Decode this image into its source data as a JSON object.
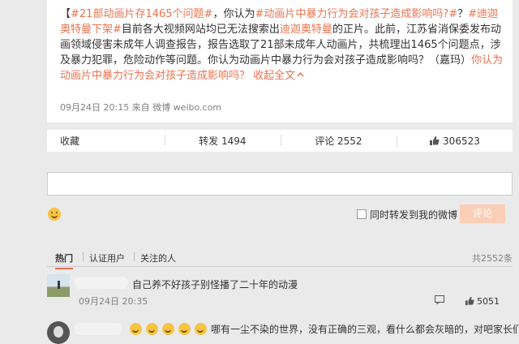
{
  "post": {
    "prefix": "【",
    "topic1": "#21部动画片存1465个问题#",
    "mid1": "，你认为",
    "topic2": "#动画片中暴力行为会对孩子造成影响吗?#",
    "mid2": "？",
    "topic3": "#迪迦奥特曼下架#",
    "body1": "目前各大视频网站均已无法搜索出",
    "link1": "迪迦奥特曼",
    "body2": "的正片。此前，江苏省消保委发布动画领域侵害未成年人调查报告，报告选取了21部未成年人动画片，共梳理出1465个问题点，涉及暴力犯罪，危险动作等问题。你认为动画片中暴力行为会对孩子造成影响吗？（嘉玛）",
    "link2": "你认为动画片中暴力行为会对孩子造成影响吗？",
    "collapse": "收起全文",
    "collapse_icon": "chevron-up"
  },
  "meta": "09月24日 20:15  来自 微博 weibo.com",
  "actions": {
    "collect": "收藏",
    "repost": "转发 1494",
    "comment": "评论 2552",
    "like": "306523"
  },
  "composer": {
    "emoji_icon": "smiley-icon",
    "also_repost": "同时转发到我的微博",
    "submit": "评论"
  },
  "tabs": {
    "hot": "热门",
    "verified": "认证用户",
    "following": "关注的人",
    "total": "共2552条"
  },
  "comments": [
    {
      "text": "自己养不好孩子别怪播了二十年的动漫",
      "time": "09月24日 20:35",
      "reply_icon": "reply-icon",
      "likes": "5051"
    },
    {
      "text": "哪有一尘不染的世界，没有正确的三观，看什么都会灰暗的，对吧家长们"
    }
  ],
  "colors": {
    "accent": "#eb7350",
    "submit_disabled": "#fbcfb6"
  }
}
